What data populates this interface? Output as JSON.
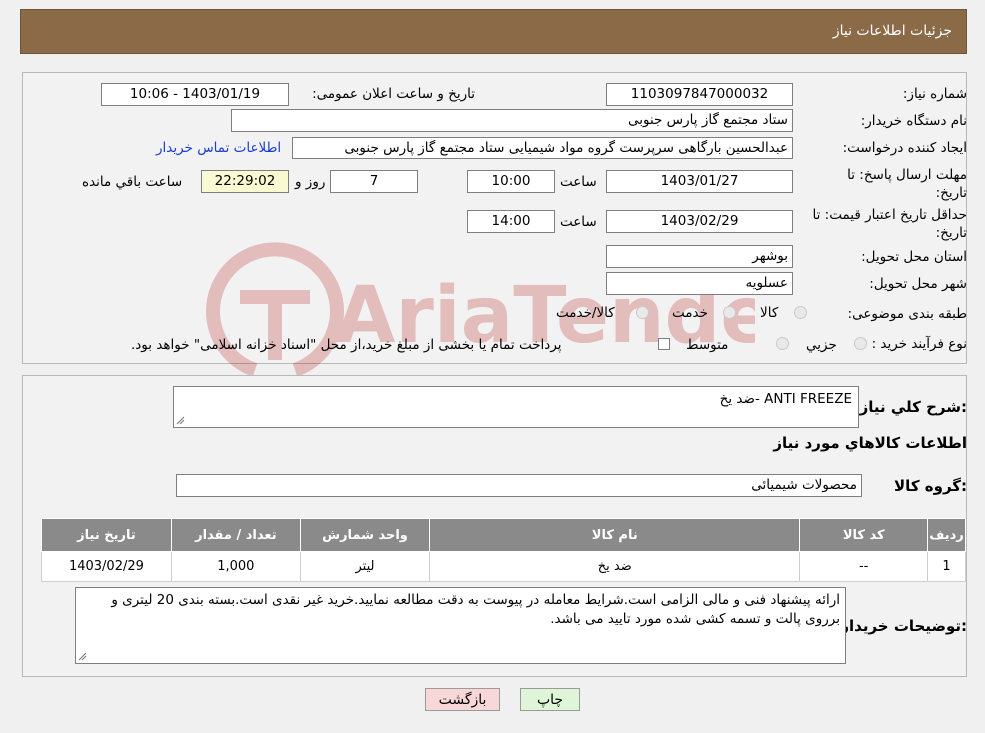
{
  "header": {
    "title": "جزئیات اطلاعات نیاز"
  },
  "form": {
    "need_number_label": "شماره نیاز:",
    "need_number": "1103097847000032",
    "announce_label": "تاریخ و ساعت اعلان عمومی:",
    "announce_value": "1403/01/19 - 10:06",
    "buyer_org_label": "نام دستگاه خریدار:",
    "buyer_org": "ستاد مجتمع گاز پارس جنوبی",
    "creator_label": "ایجاد کننده درخواست:",
    "creator": "عبدالحسین بارگاهی سرپرست گروه مواد شیمیایی ستاد مجتمع گاز پارس جنوبی",
    "contact_link": "اطلاعات تماس خریدار",
    "deadline_label": "مهلت ارسال پاسخ: تا تاریخ:",
    "deadline_date": "1403/01/27",
    "time_word": "ساعت",
    "deadline_time": "10:00",
    "days_value": "7",
    "days_word": "روز و",
    "remaining_time": "22:29:02",
    "remaining_word": "ساعت باقي مانده",
    "validity_label": "حداقل تاریخ اعتبار قیمت: تا تاریخ:",
    "validity_date": "1403/02/29",
    "validity_time": "14:00",
    "province_label": "استان محل تحویل:",
    "province": "بوشهر",
    "city_label": "شهر محل تحویل:",
    "city": "عسلویه",
    "category_label": "طبقه بندی موضوعی:",
    "category_options": [
      "کالا",
      "خدمت",
      "کالا/خدمت"
    ],
    "process_label": "نوع فرآیند خرید :",
    "process_options": [
      "جزیي",
      "متوسط"
    ],
    "process_note": "پرداخت تمام یا بخشی از مبلغ خرید،از محل \"اسناد خزانه اسلامی\" خواهد بود."
  },
  "details": {
    "summary_label": "شرح کلي نياز:",
    "summary_value": "ANTI FREEZE -ضد یخ",
    "goods_info_title": "اطلاعات کالاهاي مورد نياز",
    "goods_group_label": "گروه کالا:",
    "goods_group_value": "محصولات شیمیائی",
    "table": {
      "headers": [
        "رديف",
        "کد کالا",
        "نام کالا",
        "واحد شمارش",
        "تعداد / مقدار",
        "تاريخ نياز"
      ],
      "rows": [
        [
          "1",
          "--",
          "ضد یخ",
          "لیتر",
          "1,000",
          "1403/02/29"
        ]
      ]
    },
    "buyer_notes_label": "توضیحات خریدار:",
    "buyer_notes": "ارائه پیشنهاد فنی و مالی الزامی است.شرایط معامله در پیوست به دقت مطالعه نمایید.خرید غیر نقدی است.بسته بندی 20 لیتری و برروی پالت و تسمه کشی شده مورد تایید می باشد."
  },
  "buttons": {
    "print": "چاپ",
    "back": "بازگشت"
  },
  "watermark": {
    "text": "AriaTender.neT"
  },
  "colors": {
    "header_bg": "#8b6a47",
    "table_header_bg": "#8a8a8a",
    "link": "#1a3ccf",
    "back_btn_bg": "#f8d7d7",
    "print_btn_bg": "#dff5d8",
    "remaining_bg": "#fafad2"
  }
}
